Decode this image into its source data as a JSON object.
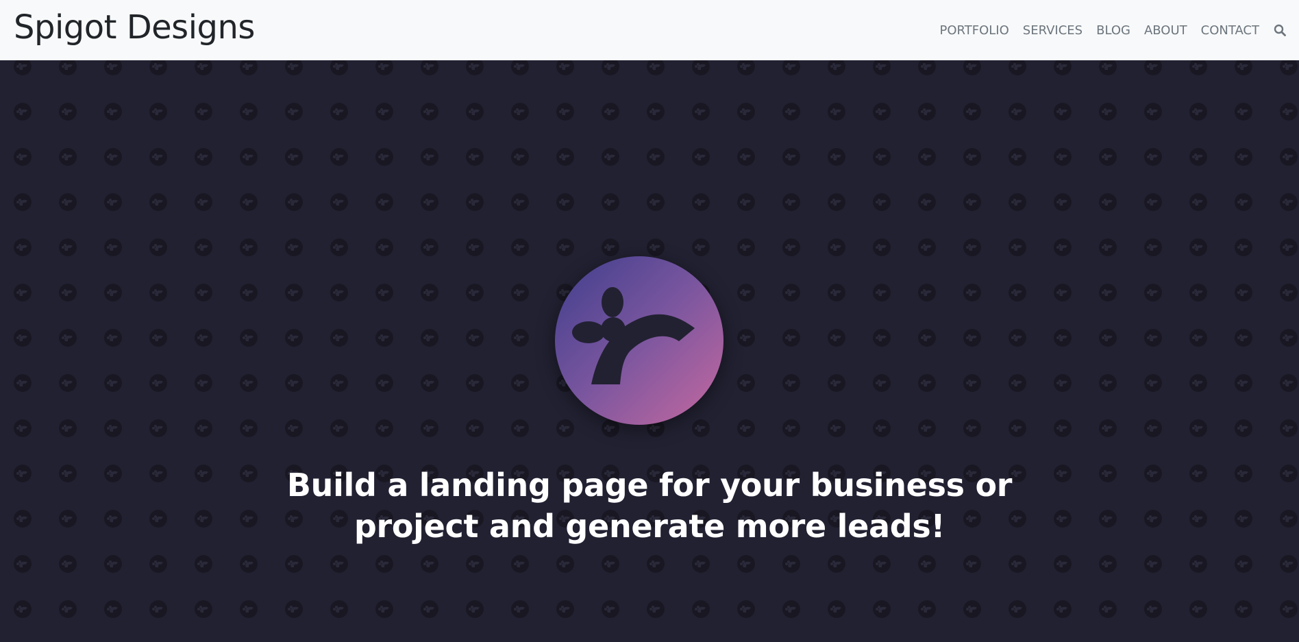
{
  "navbar": {
    "brand": "Spigot Designs",
    "links": [
      {
        "label": "PORTFOLIO"
      },
      {
        "label": "SERVICES"
      },
      {
        "label": "BLOG"
      },
      {
        "label": "ABOUT"
      },
      {
        "label": "CONTACT"
      }
    ],
    "search_icon": "search-icon"
  },
  "hero": {
    "logo_icon": "spigot-logo",
    "headline": "Build a landing page for your business or project and generate more leads!",
    "background_color": "#222132",
    "logo_gradient": [
      "#3f3e8c",
      "#c2679f"
    ]
  }
}
